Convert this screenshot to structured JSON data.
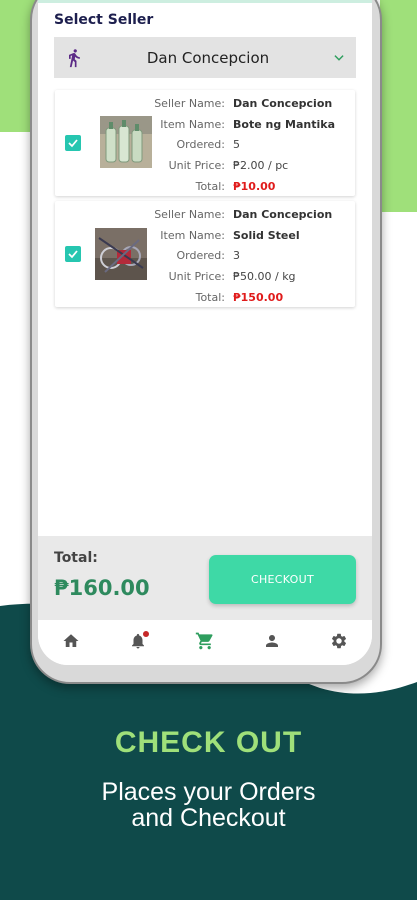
{
  "colors": {
    "accent_green": "#3ed9a6",
    "light_green": "#9fe07a",
    "dark_teal": "#0f4a4a",
    "price_red": "#e01b1b",
    "total_green": "#2e8a5e",
    "checkbox_teal": "#26c6b0"
  },
  "page": {
    "section_title": "Select Seller",
    "selected_seller": "Dan Concepcion",
    "seller_icon": "walking-person-icon",
    "dropdown_icon": "chevron-down-icon"
  },
  "labels": {
    "seller_name": "Seller Name:",
    "item_name": "Item Name:",
    "ordered": "Ordered:",
    "unit_price": "Unit Price:",
    "total": "Total:"
  },
  "items": [
    {
      "checked": true,
      "seller_name": "Dan Concepcion",
      "item_name": "Bote ng Mantika",
      "ordered": "5",
      "unit_price": "₱2.00 / pc",
      "total": "₱10.00"
    },
    {
      "checked": true,
      "seller_name": "Dan Concepcion",
      "item_name": "Solid Steel",
      "ordered": "3",
      "unit_price": "₱50.00 / kg",
      "total": "₱150.00"
    }
  ],
  "summary": {
    "total_label": "Total:",
    "total_value": "₱160.00",
    "checkout_label": "CHECKOUT"
  },
  "nav": [
    {
      "icon": "home-icon"
    },
    {
      "icon": "bell-icon",
      "has_notification": true
    },
    {
      "icon": "cart-icon",
      "active": true
    },
    {
      "icon": "person-icon"
    },
    {
      "icon": "gear-icon"
    }
  ],
  "promo": {
    "headline": "CHECK OUT",
    "subtitle_line1": "Places your Orders",
    "subtitle_line2": "and Checkout"
  }
}
